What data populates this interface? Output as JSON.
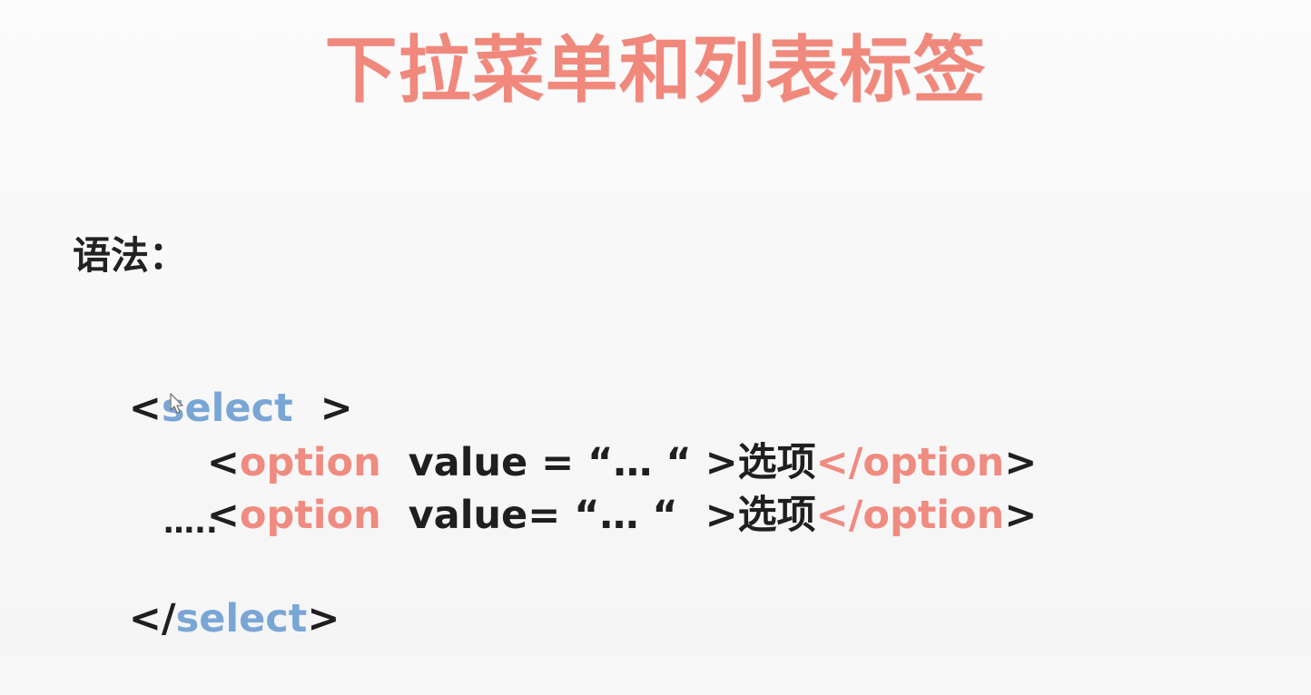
{
  "slide": {
    "title": "下拉菜单和列表标签",
    "label": "语法：",
    "code": {
      "line1": {
        "open": "<",
        "tag": "select",
        "space": "  ",
        "close": ">"
      },
      "line2": {
        "open": "<",
        "tag": "option",
        "middle": "  value = “… “ >选项",
        "closing_tag": "</option",
        "close": ">"
      },
      "line3": {
        "open": "<",
        "tag": "option",
        "middle": "  value= “… “  >选项",
        "closing_tag": "</option",
        "close": ">"
      },
      "line4": {
        "ellipsis": "….."
      },
      "line5": {
        "open": "</",
        "tag": "select",
        "close": ">"
      }
    },
    "colors": {
      "title": "#f0887c",
      "tag_blue": "#7aa6d6",
      "tag_red": "#ef8b80",
      "text": "#1f1f1f"
    },
    "icons": {
      "cursor": "mouse-pointer-icon"
    }
  }
}
